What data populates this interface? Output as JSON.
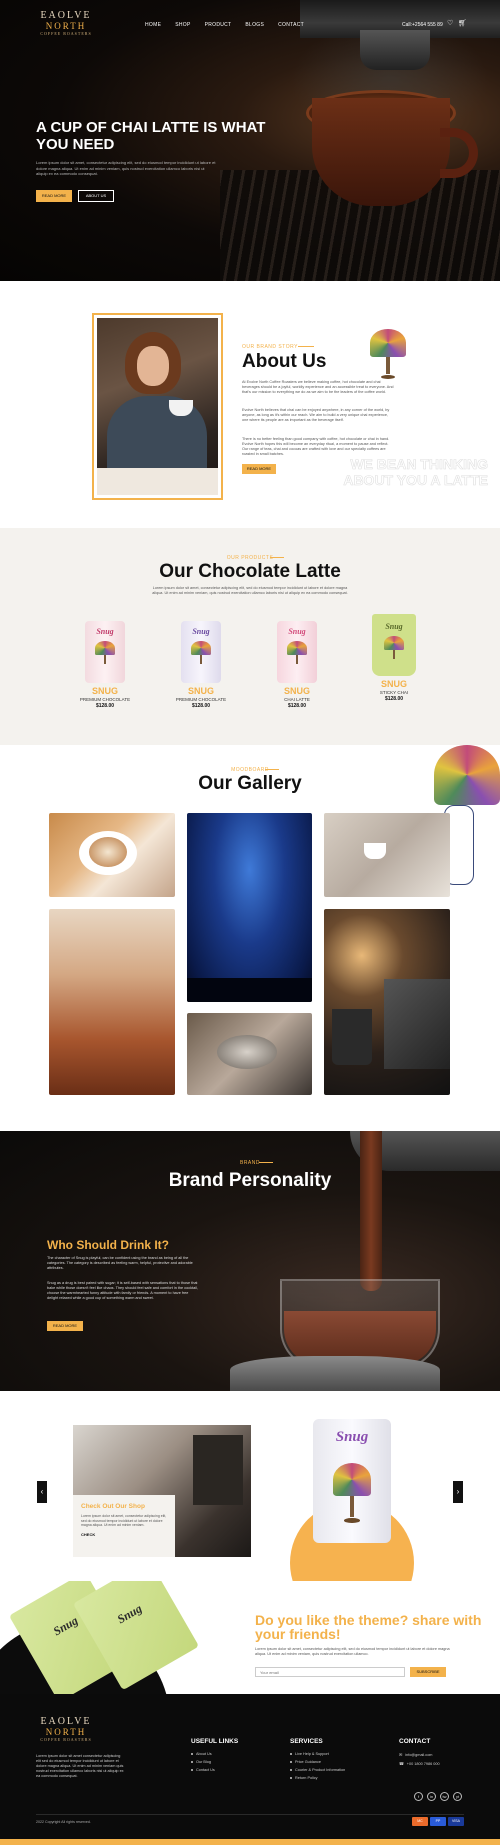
{
  "header": {
    "logo": {
      "line1": "EAOLVE",
      "line2": "NORTH",
      "line3": "COFFEE ROASTERS"
    },
    "nav": [
      "HOME",
      "SHOP",
      "PRODUCT",
      "BLOGS",
      "CONTACT"
    ],
    "call": "Call:+2564 555 89",
    "icons": [
      "heart-icon",
      "cart-icon"
    ]
  },
  "hero": {
    "title": "A CUP OF CHAI LATTE IS WHAT YOU NEED",
    "text": "Lorem ipsum dolor sit amet, consectetur adipiscing elit, sed do eiusmod tempor incididunt ut labore et dolore magna aliqua. Ut enim ad minim veniam, quis nostrud exercitation ullamco laboris nisi ut aliquip ex ea commodo consequat.",
    "btn_primary": "READ MORE",
    "btn_secondary": "ABOUT US"
  },
  "about": {
    "kicker": "OUR BRAND STORY",
    "title": "About Us",
    "p1": "At Evolve North Coffee Roasters we believe making coffee, hot chocolate and chai beverages should be a joyful, worldly experience and an accessible treat to everyone. And that's our mission to everything we do as we aim to be the leaders of the coffee world.",
    "p2": "Evolve North believes that chai can be enjoyed anywhere, in any corner of the world, by anyone, as long as it's within our reach. We aim to build a very unique chai experience, one where its people are as important as the beverage itself.",
    "p3": "There is no better feeling than good company with coffee, hot chocolate or chai in hand. Evolve North hopes this will become an everyday ritual, a moment to pause and reflect. Our range of teas, chai and cocoas are crafted with love and our specialty coffees are roasted in small batches.",
    "button": "READ MORE",
    "watermark": "WE BEAN THINKING ABOUT YOU A LATTE"
  },
  "products": {
    "kicker": "OUR PRODUCTS",
    "title": "Our Chocolate Latte",
    "desc": "Lorem ipsum dolor sit amet, consectetur adipiscing elit, sed do eiusmod tempor incididunt ut labore et dolore magna aliqua. Ut enim ad minim veniam, quis nostrud exercitation ullamco laboris nisi ut aliquip ex ea commodo consequat.",
    "items": [
      {
        "name": "SNUG",
        "sub": "PREMIUM CHOCOLATE",
        "price": "$128.00",
        "brand": "Snug"
      },
      {
        "name": "SNUG",
        "sub": "PREMIUM CHOCOLATE",
        "price": "$128.00",
        "brand": "Snug"
      },
      {
        "name": "SNUG",
        "sub": "CHAI LATTE",
        "price": "$128.00",
        "brand": "Snug"
      },
      {
        "name": "SNUG",
        "sub": "STICKY CHAI",
        "price": "$128.00",
        "brand": "Snug"
      }
    ]
  },
  "gallery": {
    "kicker": "MOODBOARD",
    "title": "Our Gallery"
  },
  "brand": {
    "kicker": "BRAND",
    "title": "Brand Personality",
    "subtitle": "Who Should Drink It?",
    "p1": "The character of Snug is playful, can be confident using the brand as being of all the categories. The category is described as feeling warm, helpful, protective and adorable attributes.",
    "p2": "Snug as a drug is best paired with sugar; it is self-based with sensations that to those that bake while those doesn't feel like chaos. They should feel safe and comfort in the cocktail, choose the warmhearted funny attitude with family or friends. A moment to have free delight relaxed while a good cup of something warm and sweet.",
    "button": "READ MORE"
  },
  "slider": {
    "card_title": "Check Out Our Shop",
    "card_text": "Lorem ipsum dolor sit amet, consectetur adipiscing elit, sed do eiusmod tempor incididunt ut labore et dolore magna aliqua. Ut enim ad minim veniam.",
    "card_cta": "CHECK",
    "can_brand": "Snug",
    "prev": "‹",
    "next": "›"
  },
  "newsletter": {
    "title": "Do you like the theme? share with your friends!",
    "text": "Lorem ipsum dolor sit amet, consectetur adipiscing elit, sed do eiusmod tempor incididunt ut labore et dolore magna aliqua. Ut enim ad minim veniam, quis nostrud exercitation ullamco.",
    "placeholder": "Your email",
    "button": "SUBSCRIBE",
    "pack_brand": "Snug"
  },
  "footer": {
    "text": "Lorem ipsum dolor sit amet consectetur adipiscing elit sed do eiusmod tempor incididunt ut labore et dolore magna aliqua. Ut enim ad minim veniam quis nostrud exercitation ullamco laboris nisi ut aliquip ex ea commodo consequat.",
    "col1": {
      "heading": "USEFUL LINKS",
      "items": [
        "About Us",
        "Our Blog",
        "Contact Us"
      ]
    },
    "col2": {
      "heading": "SERVICES",
      "items": [
        "Live Help & Support",
        "Price Guidance",
        "Courier & Product Information",
        "Return Policy"
      ]
    },
    "col3": {
      "heading": "CONTACT",
      "items": [
        "info@gmail.com",
        "+00 1800 7986 000"
      ]
    },
    "social": [
      "f",
      "in",
      "tw",
      "yt"
    ],
    "copyright": "2022 Copyright All rights reserved.",
    "payments": [
      {
        "label": "MC",
        "color": "#eb6b2b"
      },
      {
        "label": "PP",
        "color": "#2a5bd7"
      },
      {
        "label": "VISA",
        "color": "#1a3a9a"
      }
    ]
  }
}
